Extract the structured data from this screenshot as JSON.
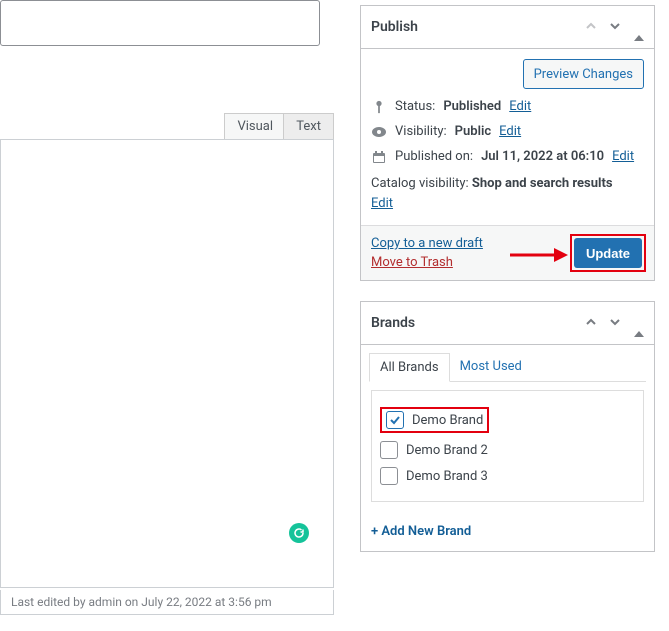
{
  "editor": {
    "tab_visual": "Visual",
    "tab_text": "Text",
    "footer": "Last edited by admin on July 22, 2022 at 3:56 pm"
  },
  "publish": {
    "title": "Publish",
    "preview": "Preview Changes",
    "status_label": "Status:",
    "status_value": "Published",
    "edit": "Edit",
    "visibility_label": "Visibility:",
    "visibility_value": "Public",
    "published_label": "Published on:",
    "published_value": "Jul 11, 2022 at 06:10",
    "catalog_label": "Catalog visibility:",
    "catalog_value": "Shop and search results",
    "copy": "Copy to a new draft",
    "trash": "Move to Trash",
    "update": "Update"
  },
  "brands": {
    "title": "Brands",
    "tab_all": "All Brands",
    "tab_most": "Most Used",
    "items": [
      {
        "label": "Demo Brand",
        "checked": true,
        "highlight": true
      },
      {
        "label": "Demo Brand 2",
        "checked": false,
        "highlight": false
      },
      {
        "label": "Demo Brand 3",
        "checked": false,
        "highlight": false
      }
    ],
    "add_new": "+ Add New Brand"
  }
}
